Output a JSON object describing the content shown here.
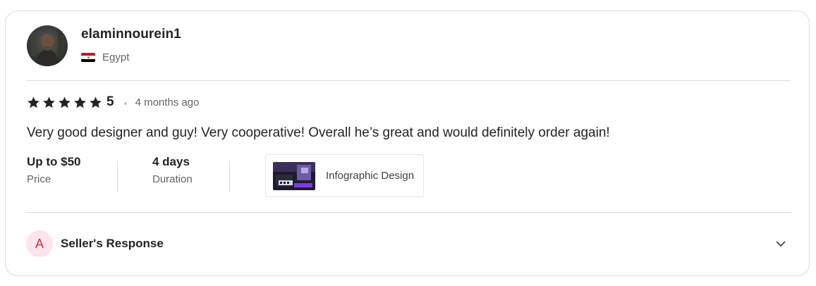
{
  "reviewer": {
    "username": "elaminnourein1",
    "country": "Egypt",
    "avatar_icon": "user-photo"
  },
  "review": {
    "rating": "5",
    "stars_filled": 5,
    "time_ago": "4 months ago",
    "text": "Very good designer and guy! Very cooperative! Overall he’s great and would definitely order again!"
  },
  "meta": {
    "price_value": "Up to $50",
    "price_label": "Price",
    "duration_value": "4 days",
    "duration_label": "Duration"
  },
  "gig": {
    "title": "Infographic Design"
  },
  "seller_response": {
    "avatar_letter": "A",
    "label": "Seller's Response",
    "expand_icon": "chevron-down-icon"
  },
  "colors": {
    "text_primary": "#222325",
    "text_secondary": "#62646a",
    "border": "#dadbdd",
    "seller_avatar_bg": "#fde4ea",
    "seller_avatar_fg": "#c2334e"
  }
}
